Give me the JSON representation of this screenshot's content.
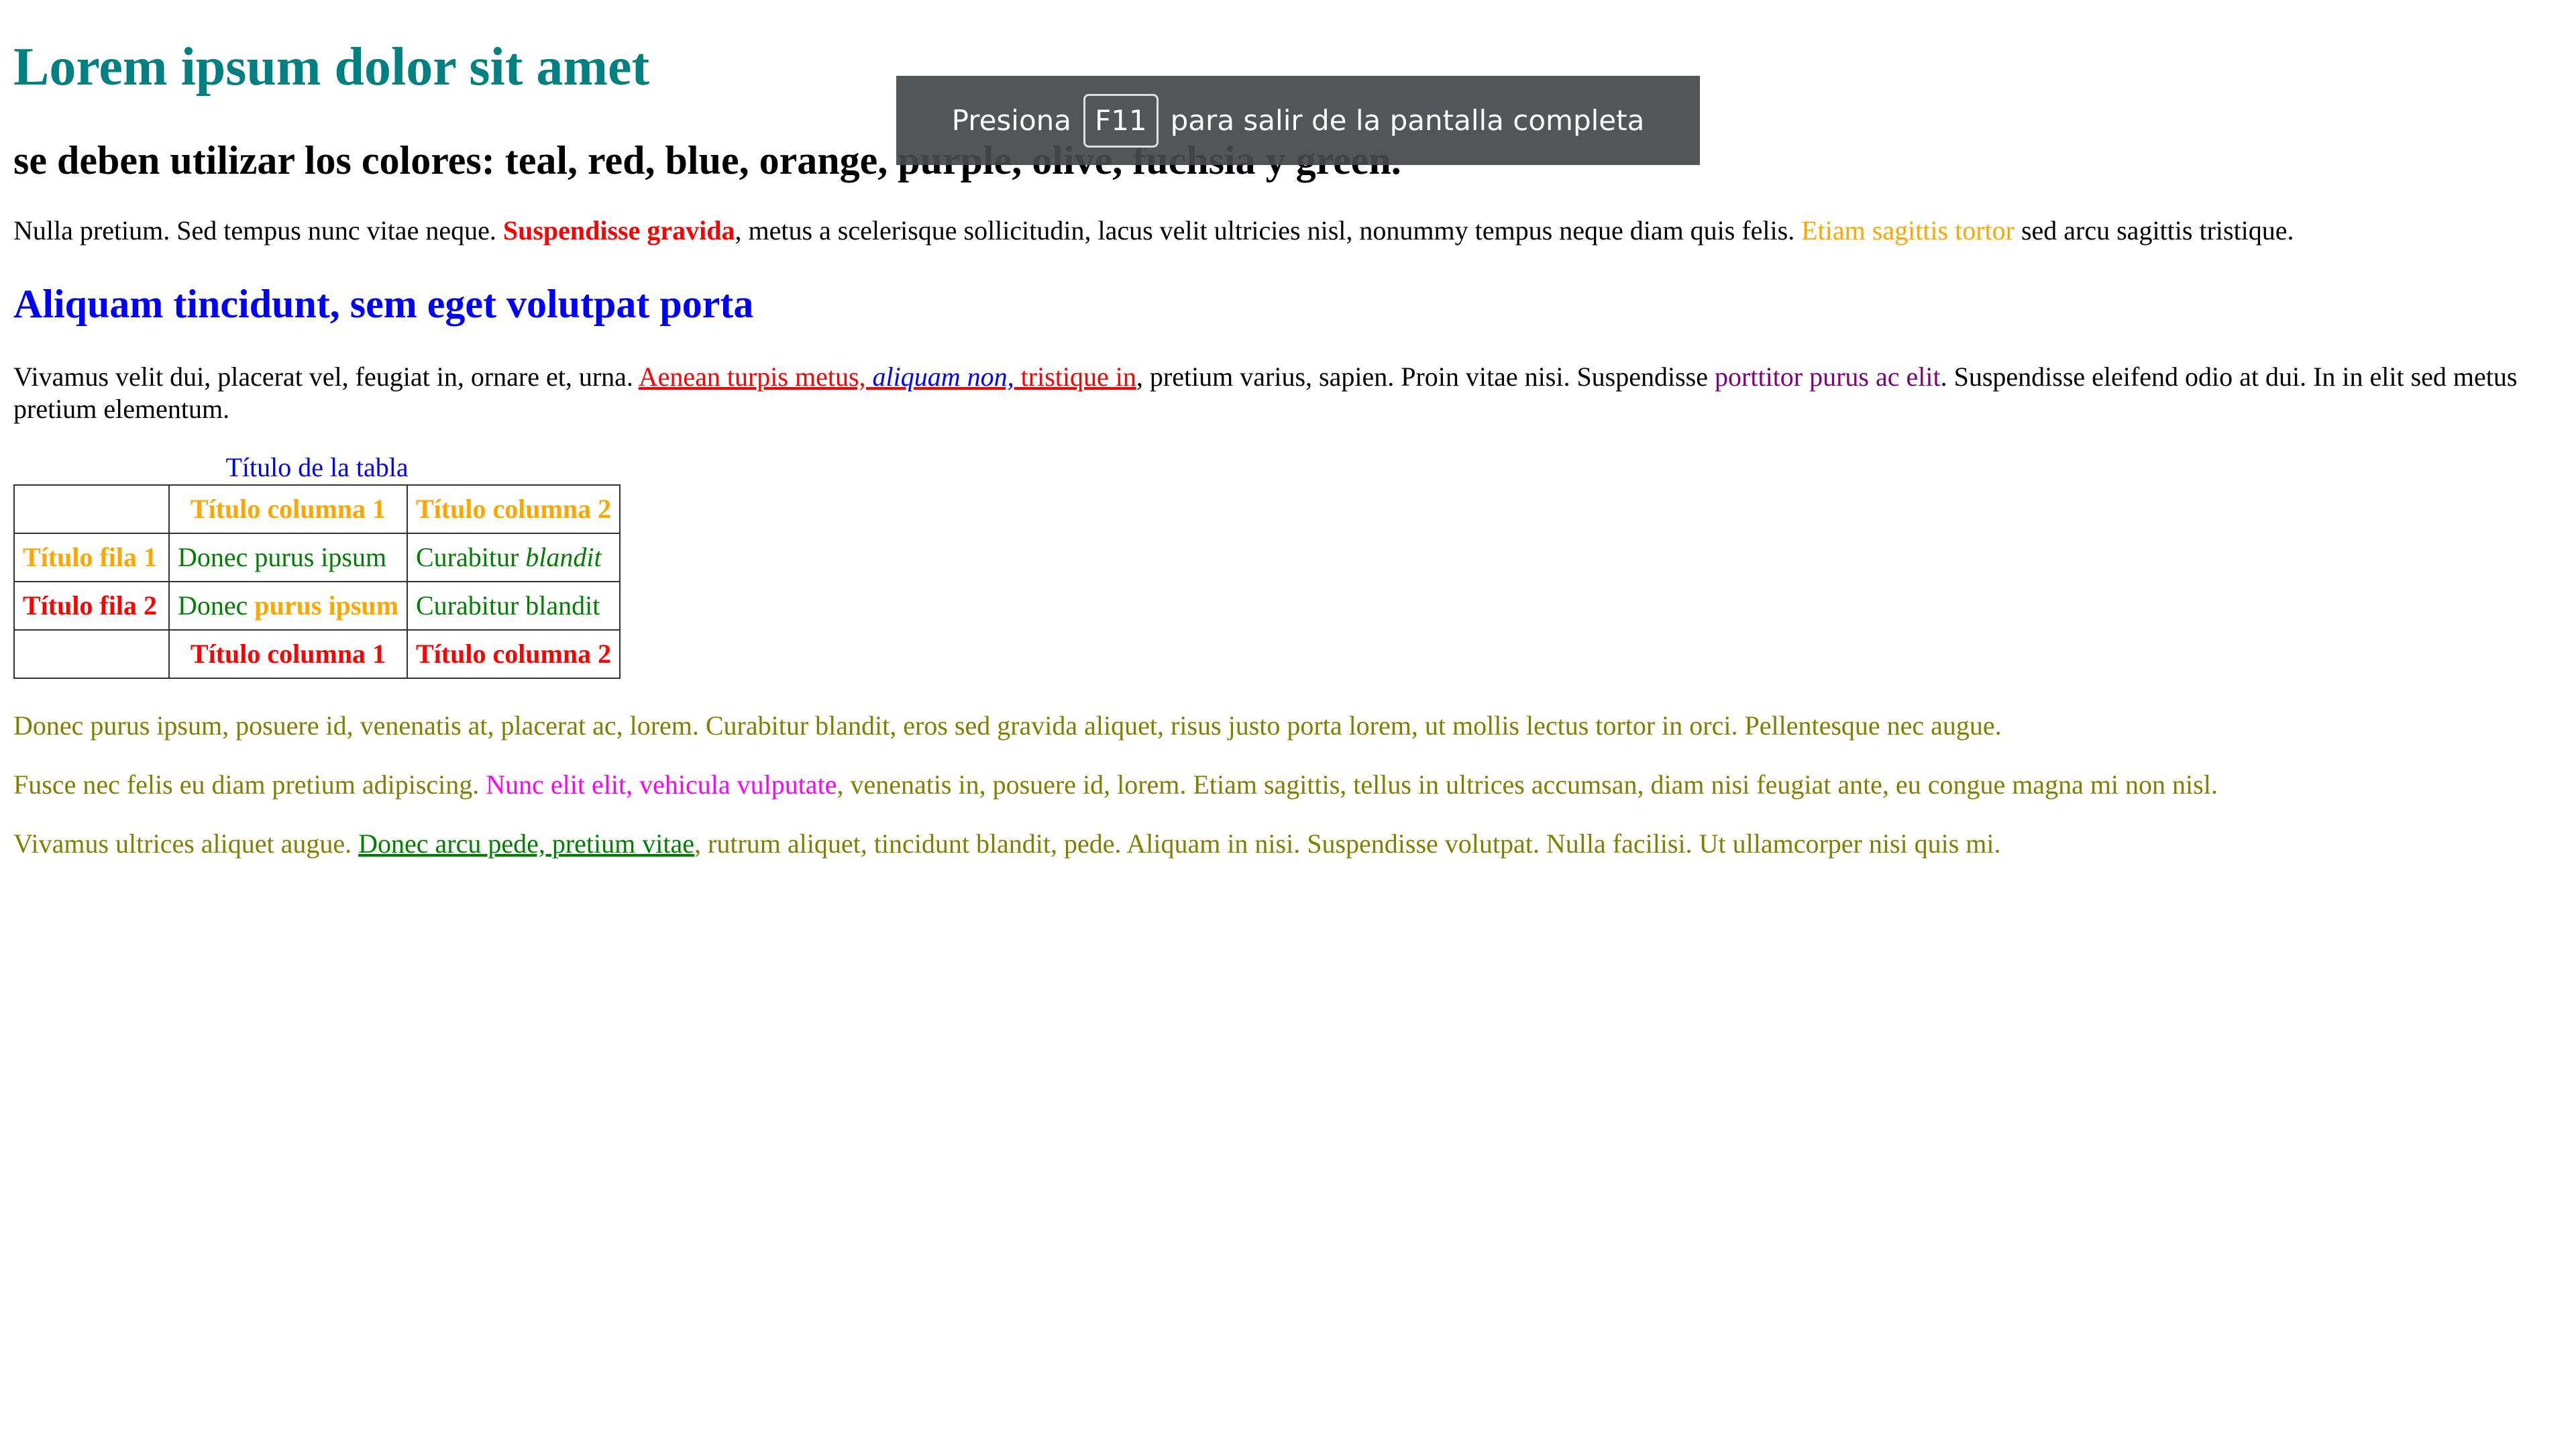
{
  "heading": "Lorem ipsum dolor sit amet",
  "subheading": "se deben utilizar los colores: teal, red, blue, orange, purple, olive, fuchsia y green.",
  "paragraph1": {
    "part1": "Nulla pretium. Sed tempus nunc vitae neque. ",
    "strong": "Suspendisse gravida",
    "part2": ", metus a scelerisque sollicitudin, lacus velit ultricies nisl, nonummy tempus neque diam quis felis. ",
    "orange": "Etiam sagittis tortor",
    "part3": " sed arcu sagittis tristique."
  },
  "section_heading": "Aliquam tincidunt, sem eget volutpat porta",
  "paragraph2": {
    "part1": "Vivamus velit dui, placerat vel, feugiat in, ornare et, urna. ",
    "link_part1": "Aenean turpis metus, ",
    "link_em": "aliquam non,",
    "link_part2": " tristique in",
    "part2": ", pretium varius, sapien. Proin vitae nisi. Suspendisse ",
    "purple": "porttitor purus ac elit",
    "part3": ". Suspendisse eleifend odio at dui. In in elit sed metus pretium elementum."
  },
  "table": {
    "caption": "Título de la tabla",
    "header_col1": "Título columna 1",
    "header_col2": "Título columna 2",
    "row1_title": "Título fila 1",
    "row1_col1": "Donec purus ipsum",
    "row1_col2_text": "Curabitur ",
    "row1_col2_em": "blandit",
    "row2_title": "Título fila 2",
    "row2_col1_text": "Donec ",
    "row2_col1_strong": "purus ipsum",
    "row2_col2": "Curabitur blandit",
    "footer_col1": "Título columna 1",
    "footer_col2": "Título columna 2"
  },
  "paragraph3": "Donec purus ipsum, posuere id, venenatis at, placerat ac, lorem. Curabitur blandit, eros sed gravida aliquet, risus justo porta lorem, ut mollis lectus tortor in orci. Pellentesque nec augue.",
  "paragraph4": {
    "part1": "Fusce nec felis eu diam pretium adipiscing. ",
    "magenta": "Nunc elit elit, vehicula vulputate",
    "part2": ", venenatis in, posuere id, lorem. Etiam sagittis, tellus in ultrices accumsan, diam nisi feugiat ante, eu congue magna mi non nisl."
  },
  "paragraph5": {
    "part1": "Vivamus ultrices aliquet augue. ",
    "link": "Donec arcu pede, pretium vitae",
    "part2": ", rutrum aliquet, tincidunt blandit, pede. Aliquam in nisi. Suspendisse volutpat. Nulla facilisi. Ut ullamcorper nisi quis mi."
  },
  "fullscreen_toast": {
    "before": "Presiona",
    "key": "F11",
    "after": "para salir de la pantalla completa"
  },
  "colors": {
    "teal": "#008080",
    "red": "#ff0000",
    "blue": "#0000ff",
    "orange": "#ffa500",
    "purple": "#800080",
    "olive": "#808000",
    "fuchsia": "#ff00ff",
    "green": "#008000"
  }
}
